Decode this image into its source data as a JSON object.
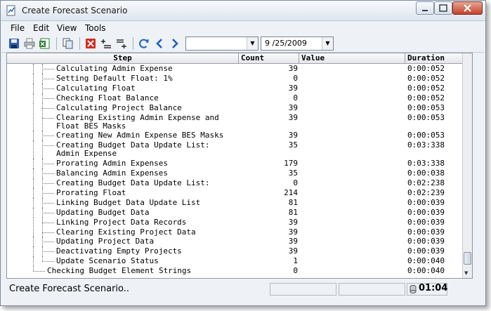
{
  "window": {
    "title": "Create Forecast Scenario"
  },
  "menu": [
    "File",
    "Edit",
    "View",
    "Tools"
  ],
  "toolbar": {
    "icons": [
      "save-icon",
      "print-icon",
      "excel-export-icon",
      "copy-icon",
      "delete-icon",
      "add-step-icon",
      "add-substep-icon",
      "refresh-icon",
      "back-arrow-icon",
      "forward-arrow-icon"
    ],
    "combo1_value": "",
    "date_value": "9 /25/2009"
  },
  "grid": {
    "columns": [
      "Step",
      "Count",
      "Value",
      "Duration"
    ],
    "rows": [
      {
        "step": [
          "Calculating Admin Expense"
        ],
        "count": "39",
        "duration": "0:00:052",
        "level": 2
      },
      {
        "step": [
          "Setting Default Float: 1%"
        ],
        "count": "0",
        "duration": "0:00:052",
        "level": 2
      },
      {
        "step": [
          "Calculating Float"
        ],
        "count": "39",
        "duration": "0:00:052",
        "level": 2
      },
      {
        "step": [
          "Checking Float Balance"
        ],
        "count": "0",
        "duration": "0:00:052",
        "level": 2
      },
      {
        "step": [
          "Calculating Project Balance"
        ],
        "count": "39",
        "duration": "0:00:053",
        "level": 2
      },
      {
        "step": [
          "Clearing Existing Admin Expense and",
          "Float BES Masks"
        ],
        "count": "39",
        "duration": "0:00:053",
        "level": 2
      },
      {
        "step": [
          "Creating New Admin Expense BES Masks"
        ],
        "count": "39",
        "duration": "0:00:053",
        "level": 2
      },
      {
        "step": [
          "Creating Budget Data Update List:",
          "Admin Expense"
        ],
        "count": "35",
        "duration": "0:03:338",
        "level": 2
      },
      {
        "step": [
          "Prorating Admin Expenses"
        ],
        "count": "179",
        "duration": "0:03:338",
        "level": 2
      },
      {
        "step": [
          "Balancing Admin Expenses"
        ],
        "count": "35",
        "duration": "0:00:038",
        "level": 2
      },
      {
        "step": [
          "Creating Budget Data Update List:"
        ],
        "count": "0",
        "duration": "0:02:238",
        "level": 2
      },
      {
        "step": [
          "Prorating Float"
        ],
        "count": "214",
        "duration": "0:02:239",
        "level": 2
      },
      {
        "step": [
          "Linking Budget Data Update List"
        ],
        "count": "81",
        "duration": "0:00:039",
        "level": 2
      },
      {
        "step": [
          "Updating Budget Data"
        ],
        "count": "81",
        "duration": "0:00:039",
        "level": 2
      },
      {
        "step": [
          "Linking Project Data Records"
        ],
        "count": "39",
        "duration": "0:00:039",
        "level": 2
      },
      {
        "step": [
          "Clearing Existing Project Data"
        ],
        "count": "39",
        "duration": "0:00:039",
        "level": 2
      },
      {
        "step": [
          "Updating Project Data"
        ],
        "count": "39",
        "duration": "0:00:039",
        "level": 2
      },
      {
        "step": [
          "Deactivating Empty Projects"
        ],
        "count": "39",
        "duration": "0:00:039",
        "level": 2
      },
      {
        "step": [
          "Update Scenario Status"
        ],
        "count": "1",
        "duration": "0:00:040",
        "level": 2
      },
      {
        "step": [
          "Checking Budget Element Strings"
        ],
        "count": "0",
        "duration": "0:00:040",
        "level": 1
      }
    ]
  },
  "status": {
    "text": "Create Forecast Scenario..",
    "clock": "01:04"
  }
}
